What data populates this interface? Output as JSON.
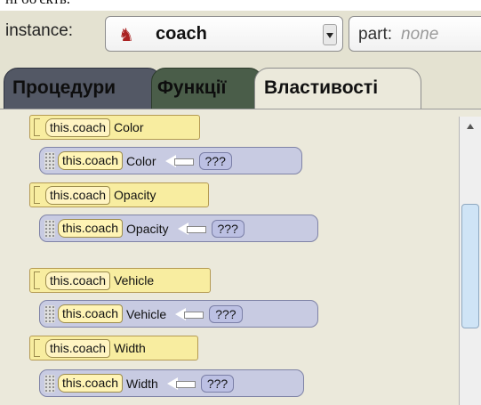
{
  "partial_text": "ні об'єкть.",
  "header": {
    "instance_label": "instance:",
    "instance_value": "coach",
    "part_label": "part:",
    "part_value": "none"
  },
  "tabs": [
    {
      "label": "Процедури"
    },
    {
      "label": "Функції"
    },
    {
      "label": "Властивості"
    }
  ],
  "properties": [
    {
      "prefix": "this.coach",
      "name": "Color",
      "setter_value": "???"
    },
    {
      "prefix": "this.coach",
      "name": "Opacity",
      "setter_value": "???"
    },
    {
      "prefix": "this.coach",
      "name": "Vehicle",
      "setter_value": "???"
    },
    {
      "prefix": "this.coach",
      "name": "Width",
      "setter_value": "???"
    }
  ]
}
